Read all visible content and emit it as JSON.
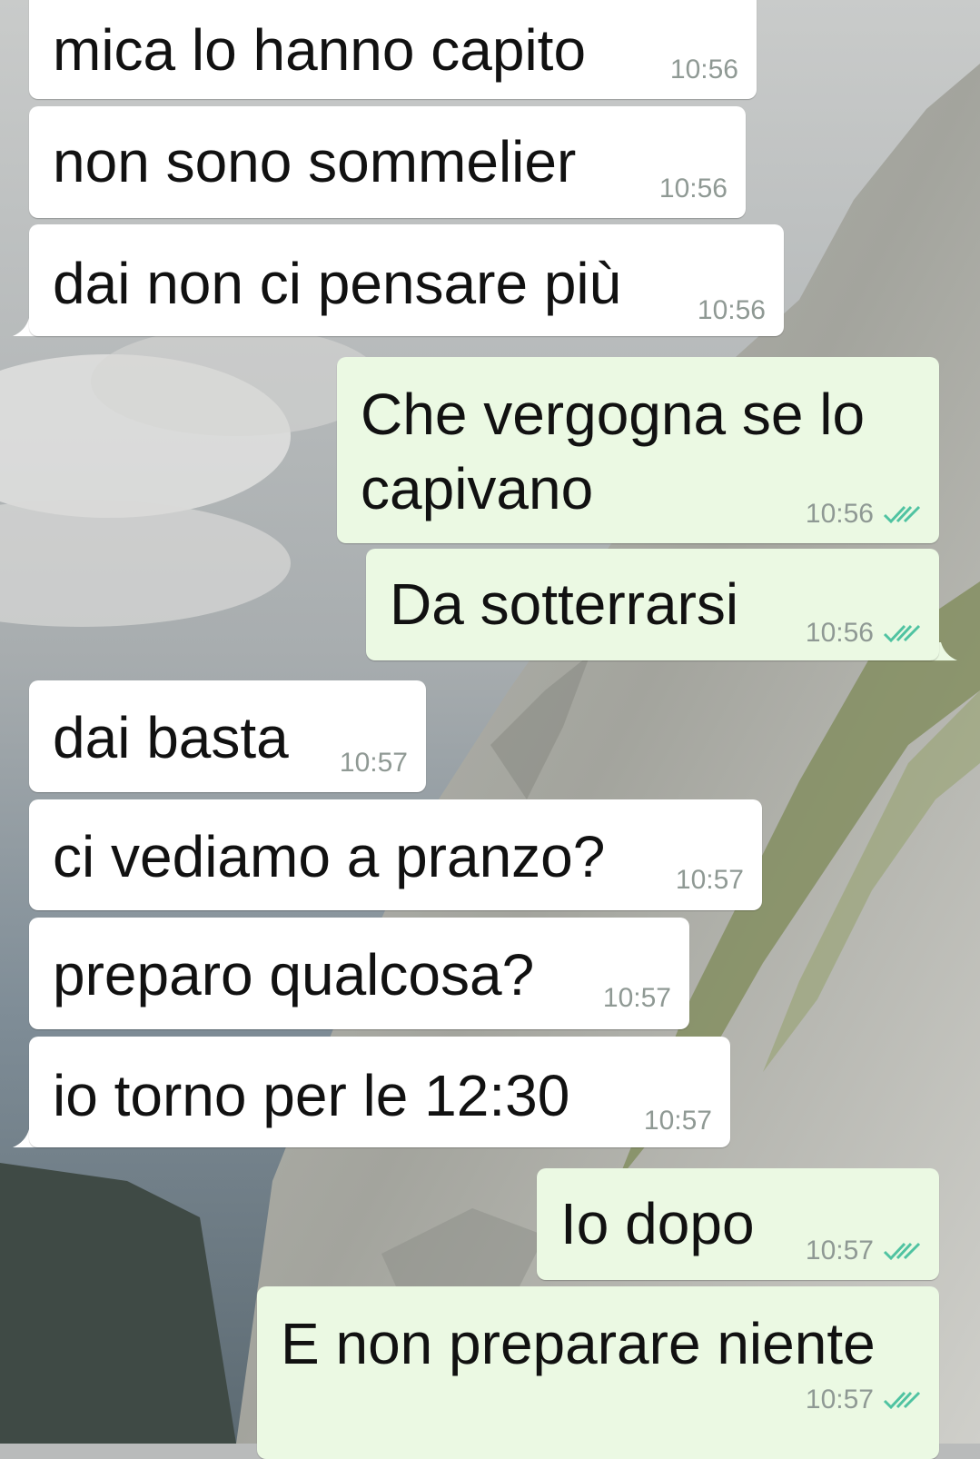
{
  "chat": {
    "messages": [
      {
        "text": "mica lo hanno capito",
        "time": "10:56",
        "direction": "in"
      },
      {
        "text": "non sono sommelier",
        "time": "10:56",
        "direction": "in"
      },
      {
        "text": "dai non ci pensare più",
        "time": "10:56",
        "direction": "in"
      },
      {
        "text_line1": "Che vergogna se lo",
        "text_line2": "capivano",
        "time": "10:56",
        "direction": "out",
        "status": "read"
      },
      {
        "text": "Da sotterrarsi",
        "time": "10:56",
        "direction": "out",
        "status": "read"
      },
      {
        "text": "dai basta",
        "time": "10:57",
        "direction": "in"
      },
      {
        "text": "ci vediamo a pranzo?",
        "time": "10:57",
        "direction": "in"
      },
      {
        "text": "preparo qualcosa?",
        "time": "10:57",
        "direction": "in"
      },
      {
        "text": "io torno per le 12:30",
        "time": "10:57",
        "direction": "in"
      },
      {
        "text": "Io dopo",
        "time": "10:57",
        "direction": "out",
        "status": "read"
      },
      {
        "text": "E non preparare niente",
        "time": "10:57",
        "direction": "out",
        "status": "read"
      }
    ]
  },
  "colors": {
    "incoming_bubble": "#ffffff",
    "outgoing_bubble": "#ebf9e3",
    "read_tick": "#4fc3a1",
    "timestamp": "#8f9994"
  },
  "icons": {
    "read_receipt": "double-check-icon"
  }
}
